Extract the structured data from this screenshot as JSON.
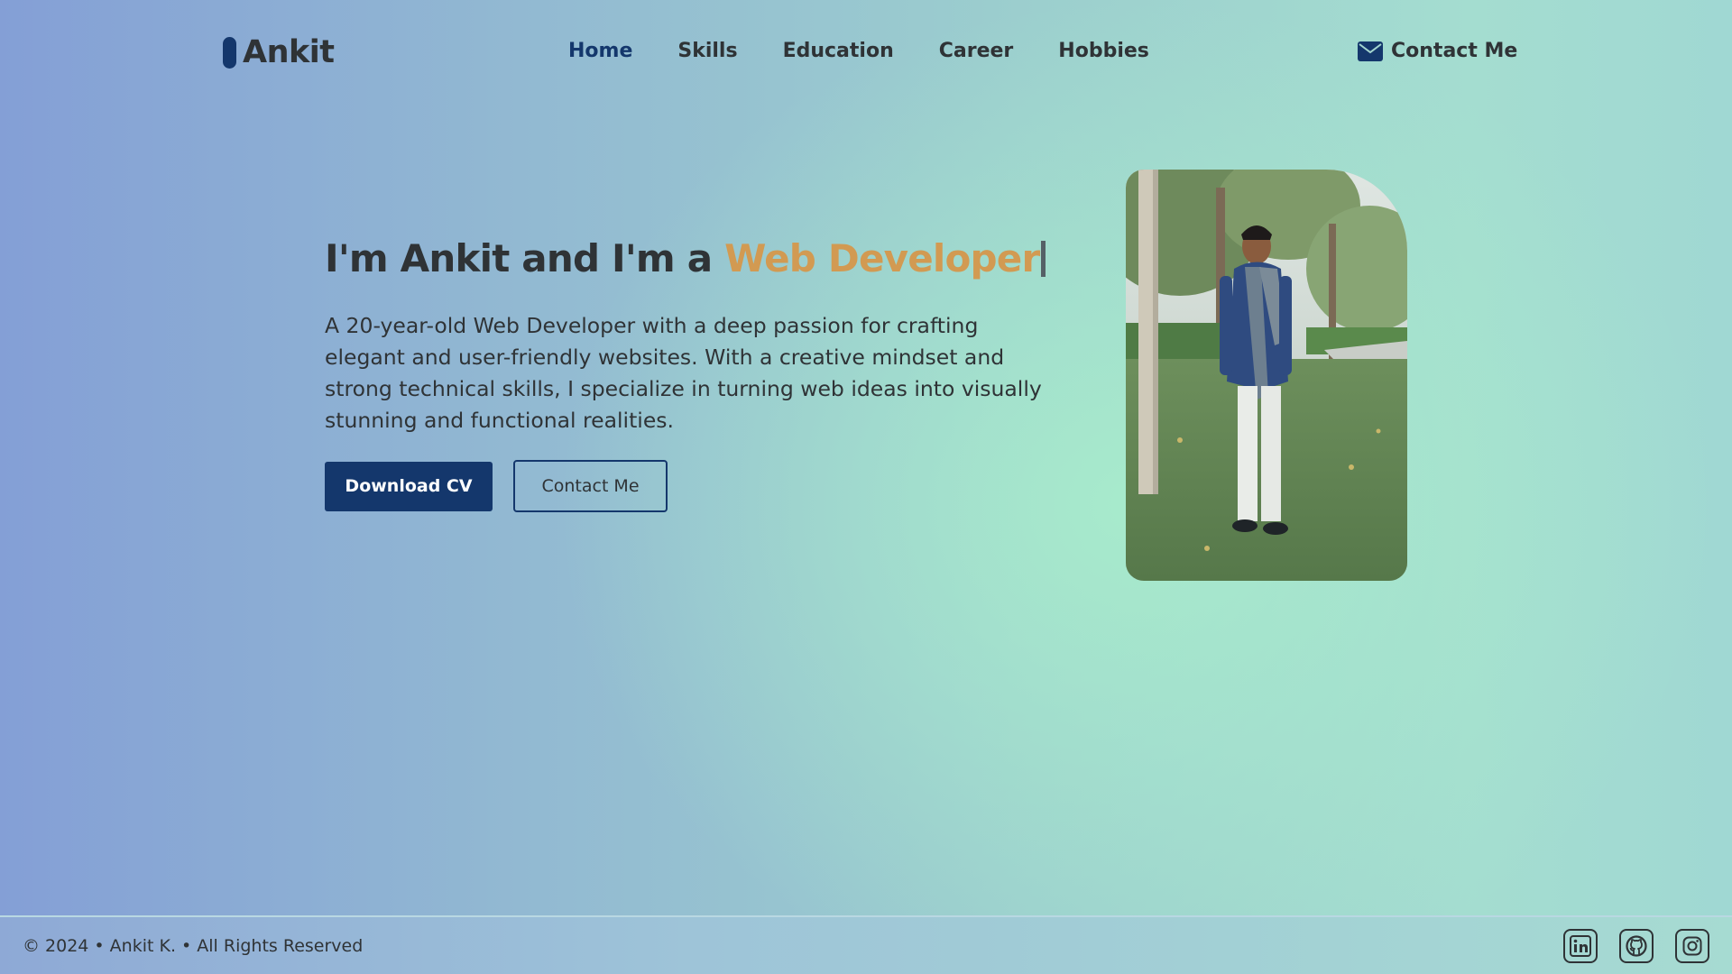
{
  "brand": {
    "name": "Ankit"
  },
  "nav": {
    "items": [
      {
        "label": "Home",
        "active": true
      },
      {
        "label": "Skills",
        "active": false
      },
      {
        "label": "Education",
        "active": false
      },
      {
        "label": "Career",
        "active": false
      },
      {
        "label": "Hobbies",
        "active": false
      }
    ],
    "contact_label": "Contact Me",
    "contact_icon": "envelope-icon"
  },
  "hero": {
    "headline_prefix": "I'm Ankit and I'm a ",
    "headline_role": "Web Developer",
    "description": "A 20-year-old Web Developer with a deep passion for crafting elegant and user-friendly websites. With a creative mindset and strong technical skills, I specialize in turning web ideas into visually stunning and functional realities.",
    "primary_button": "Download CV",
    "secondary_button": "Contact Me"
  },
  "footer": {
    "copyright": "© 2024 • Ankit K. • All Rights Reserved",
    "social": [
      "linkedin-icon",
      "github-icon",
      "instagram-icon"
    ]
  },
  "colors": {
    "primary": "#14376c",
    "accent": "#d29a52",
    "text": "#2f3336"
  }
}
